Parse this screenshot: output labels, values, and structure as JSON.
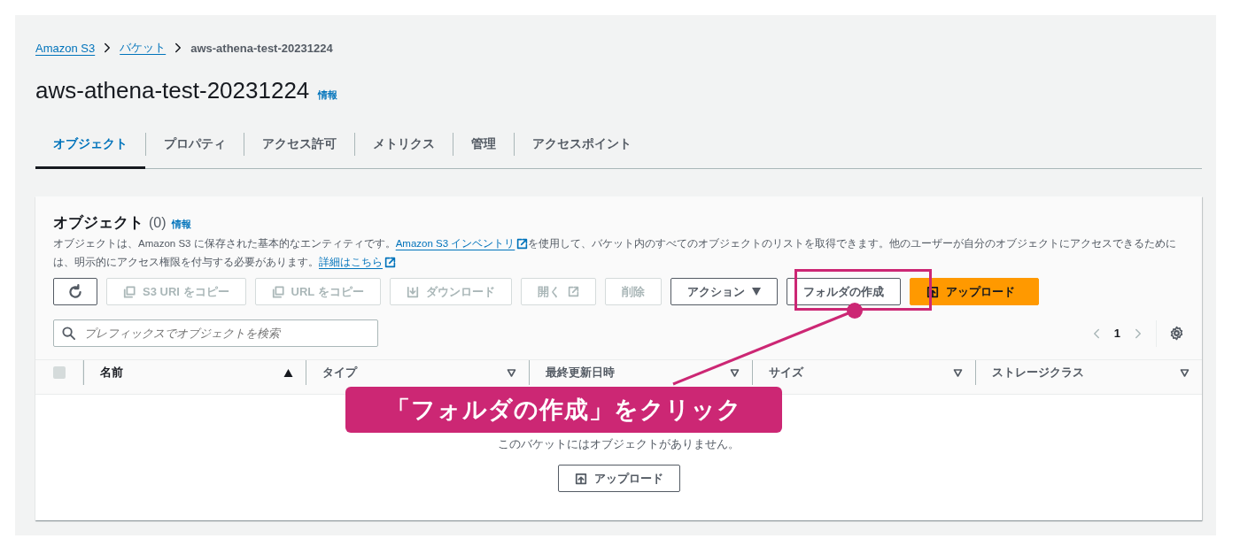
{
  "breadcrumb": [
    {
      "label": "Amazon S3",
      "kind": "link"
    },
    {
      "label": "バケット",
      "kind": "link"
    },
    {
      "label": "aws-athena-test-20231224",
      "kind": "current"
    }
  ],
  "page": {
    "title": "aws-athena-test-20231224",
    "info": "情報"
  },
  "tabs": [
    {
      "label": "オブジェクト",
      "selected": true
    },
    {
      "label": "プロパティ",
      "selected": false
    },
    {
      "label": "アクセス許可",
      "selected": false
    },
    {
      "label": "メトリクス",
      "selected": false
    },
    {
      "label": "管理",
      "selected": false
    },
    {
      "label": "アクセスポイント",
      "selected": false
    }
  ],
  "objects": {
    "title": "オブジェクト",
    "count": "(0)",
    "info": "情報",
    "description": [
      {
        "kind": "text",
        "text": "オブジェクトは、Amazon S3 に保存された基本的なエンティティです。"
      },
      {
        "kind": "link",
        "text": "Amazon S3 インベントリ"
      },
      {
        "kind": "text",
        "text": "を使用して、バケット内のすべてのオブジェクトのリストを取得できます。他のユーザーが自分のオブジェクトにアクセスできるためには、明示的にアクセス権限を付与する必要があります。"
      },
      {
        "kind": "link",
        "text": "詳細はこちら"
      }
    ],
    "toolbar": [
      {
        "kind": "refresh",
        "disabled": false
      },
      {
        "kind": "copy",
        "label": "S3 URI をコピー",
        "disabled": true
      },
      {
        "kind": "copy",
        "label": "URL をコピー",
        "disabled": true
      },
      {
        "kind": "download",
        "label": "ダウンロード",
        "disabled": true
      },
      {
        "kind": "open",
        "label": "開く",
        "disabled": true
      },
      {
        "kind": "plain",
        "label": "削除",
        "disabled": true
      },
      {
        "kind": "dropdown",
        "label": "アクション",
        "disabled": false
      },
      {
        "kind": "plain",
        "label": "フォルダの作成",
        "disabled": false
      },
      {
        "kind": "primary",
        "label": "アップロード",
        "disabled": false
      }
    ],
    "search": {
      "placeholder": "プレフィックスでオブジェクトを検索"
    },
    "page_number": "1",
    "select_all": {
      "checked": false
    },
    "columns": [
      {
        "label": "名前",
        "kind": "sorted"
      },
      {
        "label": "タイプ",
        "kind": "sortable"
      },
      {
        "label": "最終更新日時",
        "kind": "sortable"
      },
      {
        "label": "サイズ",
        "kind": "sortable"
      },
      {
        "label": "ストレージクラス",
        "kind": "sortable"
      }
    ],
    "empty": {
      "message": "このバケットにはオブジェクトがありません。",
      "button": "アップロード"
    }
  },
  "callout": {
    "text": "「フォルダの作成」をクリック"
  }
}
